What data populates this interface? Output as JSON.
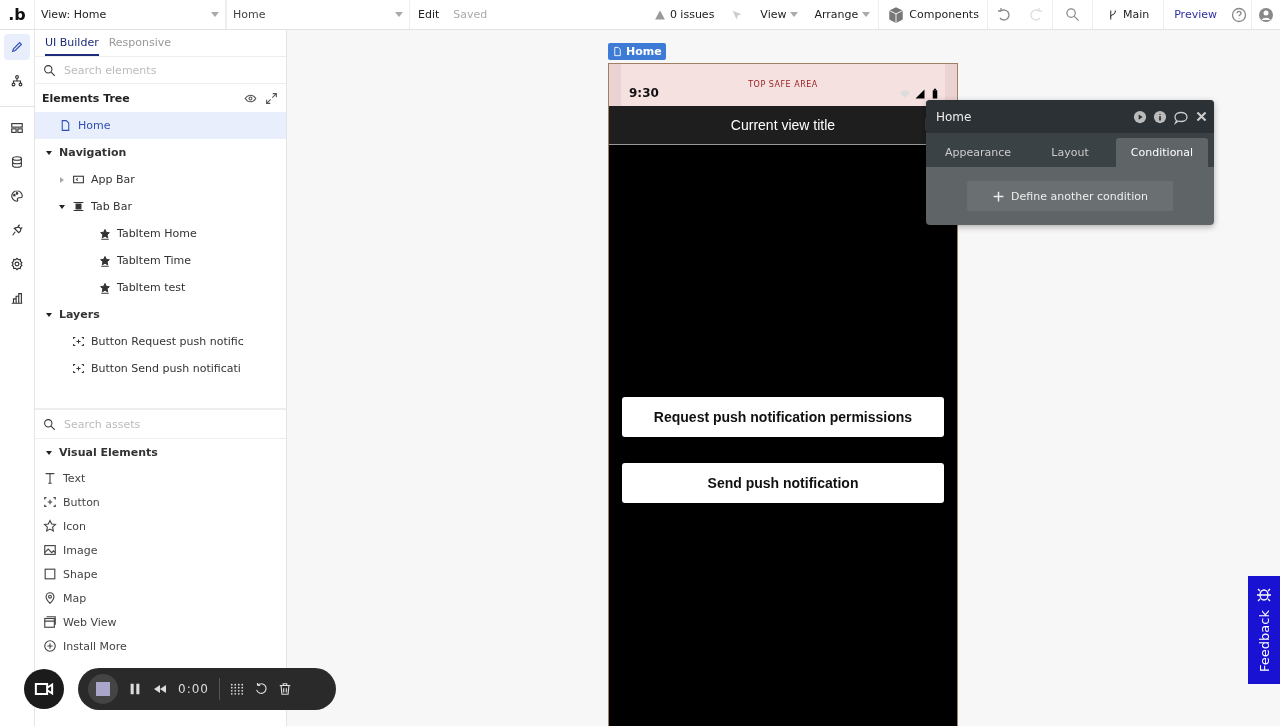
{
  "topbar": {
    "logo": ".b",
    "view_select": "View: Home",
    "page_select": "Home",
    "edit": "Edit",
    "save_status": "Saved",
    "issues": "0 issues",
    "menus": [
      {
        "label": "View"
      },
      {
        "label": "Arrange"
      }
    ],
    "components": "Components",
    "branch": "Main",
    "preview": "Preview"
  },
  "rail": [
    {
      "kind": "pencil",
      "selected": true
    },
    {
      "kind": "tree",
      "selected": false
    },
    {
      "kind": "layout",
      "selected": false
    },
    {
      "kind": "database",
      "selected": false
    },
    {
      "kind": "palette",
      "selected": false
    },
    {
      "kind": "plug",
      "selected": false
    },
    {
      "kind": "gear",
      "selected": false
    },
    {
      "kind": "chart",
      "selected": false
    }
  ],
  "panel_tabs": [
    {
      "label": "UI Builder",
      "selected": true
    },
    {
      "label": "Responsive",
      "selected": false
    }
  ],
  "element_search": {
    "placeholder": "Search elements"
  },
  "tree_title": "Elements Tree",
  "tree": [
    {
      "label": "Home",
      "kind": "page",
      "selected": true
    },
    {
      "label": "Navigation",
      "kind": "section",
      "expanded": true,
      "selected": false,
      "children": [
        {
          "label": "App Bar",
          "kind": "appbar",
          "expanded": false,
          "selected": false
        },
        {
          "label": "Tab Bar",
          "kind": "tabbar",
          "expanded": true,
          "selected": false,
          "children": [
            {
              "label": "TabItem Home",
              "kind": "tabitem",
              "selected": false
            },
            {
              "label": "TabItem Time",
              "kind": "tabitem",
              "selected": false
            },
            {
              "label": "TabItem test",
              "kind": "tabitem",
              "selected": false
            }
          ]
        }
      ]
    },
    {
      "label": "Layers",
      "kind": "section",
      "expanded": true,
      "selected": false,
      "children": [
        {
          "label": "Button Request push notific",
          "kind": "button",
          "selected": false
        },
        {
          "label": "Button Send push notificati",
          "kind": "button",
          "selected": false
        }
      ]
    }
  ],
  "asset_search": {
    "placeholder": "Search assets"
  },
  "asset_group": {
    "label": "Visual Elements",
    "expanded": true
  },
  "assets": [
    {
      "label": "Text",
      "kind": "text"
    },
    {
      "label": "Button",
      "kind": "button"
    },
    {
      "label": "Icon",
      "kind": "icon"
    },
    {
      "label": "Image",
      "kind": "image"
    },
    {
      "label": "Shape",
      "kind": "shape"
    },
    {
      "label": "Map",
      "kind": "map"
    },
    {
      "label": "Web View",
      "kind": "webview"
    },
    {
      "label": "Install More",
      "kind": "install"
    }
  ],
  "page_tag": "Home",
  "phone": {
    "time": "9:30",
    "safe_area": "TOP SAFE AREA",
    "title": "Current view title",
    "buttons": [
      "Request push notification permissions",
      "Send push notification"
    ]
  },
  "inspector": {
    "title": "Home",
    "tabs": [
      {
        "label": "Appearance",
        "selected": false
      },
      {
        "label": "Layout",
        "selected": false
      },
      {
        "label": "Conditional",
        "selected": true
      }
    ],
    "action": "Define another condition"
  },
  "recorder": {
    "time": "0:00"
  },
  "feedback": "Feedback"
}
